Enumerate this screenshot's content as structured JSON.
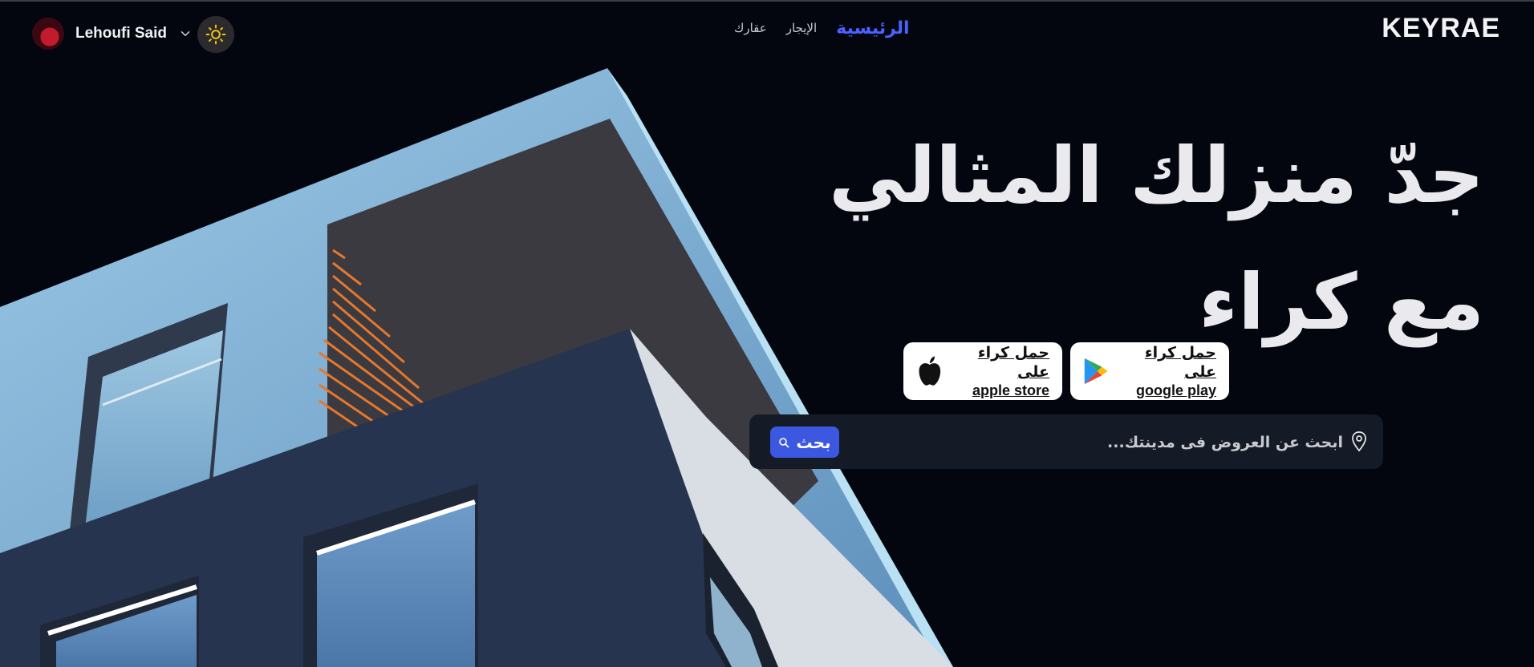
{
  "header": {
    "logo": "KEYRAE",
    "user_name": "Lehoufi Said",
    "nav": [
      {
        "label": "الرئيسية",
        "active": true
      },
      {
        "label": "الإيجار",
        "active": false
      },
      {
        "label": "عقارك",
        "active": false
      }
    ]
  },
  "hero": {
    "headline_line1": "جدّ منزلك المثالي",
    "headline_line2": "مع كراء"
  },
  "stores": {
    "google_line1": "حمل كراء على",
    "google_line2": "google play",
    "apple_line1": "حمل كراء على",
    "apple_line2": "apple store"
  },
  "search": {
    "placeholder": "ابحث عن العروض فى مدينتك...",
    "button_label": "بحث"
  },
  "colors": {
    "accent": "#3c58e0",
    "nav_active": "#4a62ff",
    "background": "#03060f"
  }
}
